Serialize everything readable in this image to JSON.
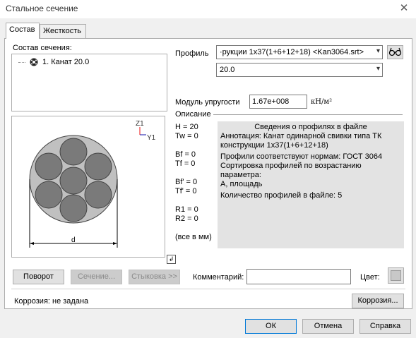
{
  "window": {
    "title": "Стальное сечение",
    "close": "✕"
  },
  "tabs": [
    "Состав",
    "Жесткость"
  ],
  "left": {
    "composition_label": "Состав сечения:",
    "items": [
      "1. Канат 20.0"
    ]
  },
  "profile": {
    "label": "Профиль",
    "value": "·рукции 1x37(1+6+12+18) <Kan3064.srt>",
    "size_value": "20.0",
    "glasses_icon": "glasses-icon"
  },
  "modulus": {
    "label": "Модуль упругости",
    "value": "1.67e+008",
    "unit": "кН/м²"
  },
  "description": {
    "label": "Описание",
    "params": [
      "H = 20",
      "Tw = 0",
      "Bf = 0",
      "Tf = 0",
      "Bf' = 0",
      "Tf' = 0",
      "R1 = 0",
      "R2 = 0",
      "(все в мм)"
    ],
    "info_title": "Сведения о профилях в файле",
    "info_lines": [
      "Аннотация: Канат одинарной свивки типа ТК",
      "конструкции 1x37(1+6+12+18)",
      "Профили соответствуют нормам: ГОСТ 3064",
      "Сортировка профилей по возрастанию параметра:",
      "А, площадь",
      "Количество профилей в файле: 5"
    ]
  },
  "preview": {
    "axis_z": "Z1",
    "axis_y": "Y1",
    "dim_label": "d"
  },
  "buttons": {
    "rotate": "Поворот",
    "section": "Сечение...",
    "joining": "Стыковка >>",
    "comment_label": "Комментарий:",
    "comment_value": "",
    "color_label": "Цвет:",
    "corrosion_status": "Коррозия: не задана",
    "corrosion": "Коррозия...",
    "ok": "ОК",
    "cancel": "Отмена",
    "help": "Справка"
  }
}
